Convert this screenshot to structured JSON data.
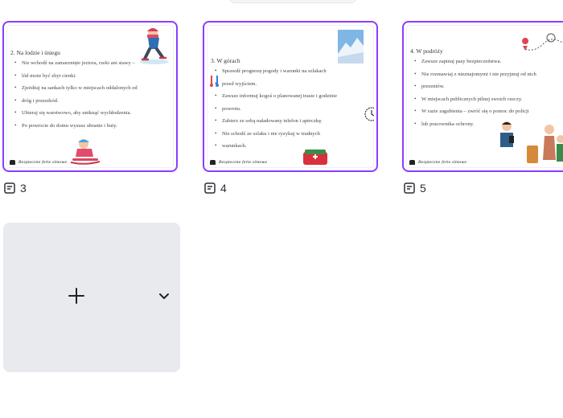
{
  "slides": [
    {
      "number": "3",
      "title": "2. Na lodzie i śniegu",
      "bullets": [
        "Nie wchodź na zamarznięte jeziora, rzeki ani stawy –",
        "lód może być zbyt cienki.",
        "Zjeżdżaj na sankach tylko w miejscach oddalonych od",
        "dróg i przeszkód.",
        "Ubieraj się warstwowo, aby uniknąć wychłodzenia.",
        "Po powrocie do domu wysusz ubranie i buty."
      ],
      "signature": "Bezpieczne ferie zimowe"
    },
    {
      "number": "4",
      "title": "3. W górach",
      "bullets": [
        "Sprawdź prognozę pogody i warunki na szlakach",
        "przed wyjściem.",
        "Zawsze informuj kogoś o planowanej trasie i godzinie",
        "powrotu.",
        "Zabierz ze sobą naładowany telefon i apteczkę.",
        "Nie schodź ze szlaku i nie ryzykuj w trudnych",
        "warunkach."
      ],
      "signature": "Bezpieczne ferie zimowe"
    },
    {
      "number": "5",
      "title": "4. W podróży",
      "bullets": [
        "Zawsze zapinaj pasy bezpieczeństwa.",
        "Nie rozmawiaj z nieznajomymi i nie przyjmuj od nich",
        "prezentów.",
        "W miejscach publicznych pilnuj swoich rzeczy.",
        "W razie zagubienia – zwróć się o pomoc do policji",
        "lub pracownika ochrony."
      ],
      "signature": "Bezpieczne ferie zimowe"
    }
  ],
  "icons": {
    "page_note": "notes-icon",
    "add": "plus-icon",
    "menu": "chevron-down-icon"
  },
  "colors": {
    "selection": "#8b3dff",
    "add_card_bg": "#e9eaee"
  }
}
